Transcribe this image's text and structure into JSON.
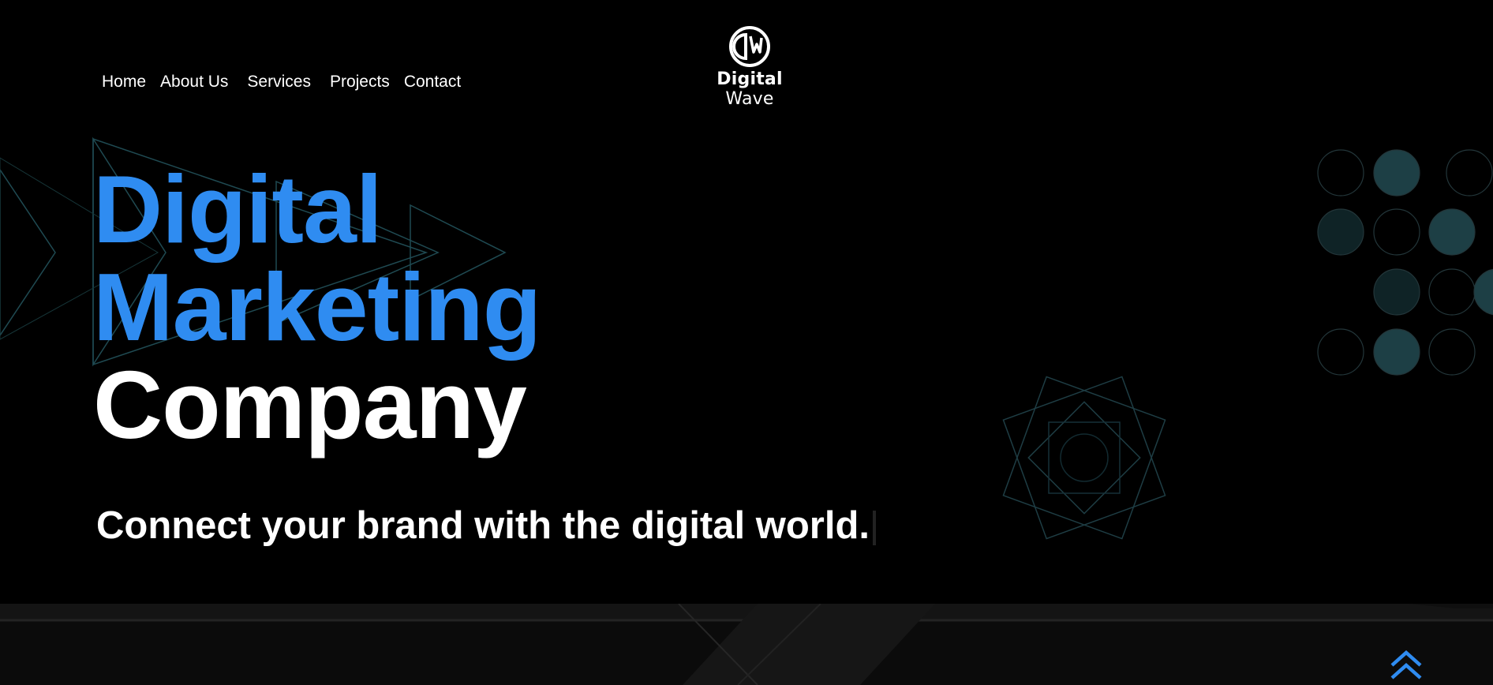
{
  "brand": {
    "name_bold": "Digital",
    "name_light": "Wave",
    "logo_icon": "dw-monogram-icon"
  },
  "nav": {
    "items": [
      {
        "label": "Home"
      },
      {
        "label": "About Us"
      },
      {
        "label": "Services"
      },
      {
        "label": "Projects"
      },
      {
        "label": "Contact"
      }
    ]
  },
  "hero": {
    "title_line1": "Digital",
    "title_line2": "Marketing",
    "title_line3": "Company",
    "tagline": "Connect your brand with the digital world."
  },
  "colors": {
    "accent": "#2f8cf1",
    "background": "#000000",
    "teal_dot": "#1a3a40"
  },
  "scroll_top": {
    "icon": "double-chevron-up-icon"
  }
}
